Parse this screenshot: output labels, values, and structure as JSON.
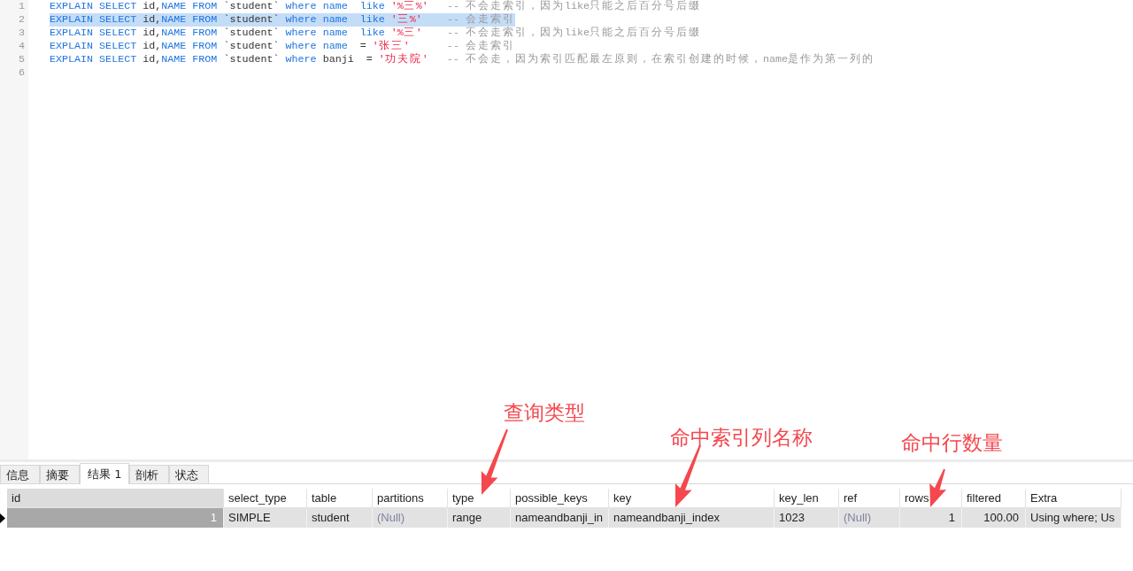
{
  "editor": {
    "lines": [
      {
        "number": "1",
        "selected": false,
        "tokens": [
          {
            "kind": "keyword",
            "text": "EXPLAIN SELECT"
          },
          {
            "kind": "plain",
            "text": " id,"
          },
          {
            "kind": "keyword",
            "text": "NAME FROM"
          },
          {
            "kind": "plain",
            "text": " `student` "
          },
          {
            "kind": "keyword",
            "text": "where name  like "
          },
          {
            "kind": "string",
            "text": "'%三%'"
          },
          {
            "kind": "comment",
            "text": "   -- 不会走索引，因为like只能之后百分号后缀"
          }
        ]
      },
      {
        "number": "2",
        "selected": true,
        "tokens": [
          {
            "kind": "keyword",
            "text": "EXPLAIN SELECT"
          },
          {
            "kind": "plain",
            "text": " id,"
          },
          {
            "kind": "keyword",
            "text": "NAME FROM"
          },
          {
            "kind": "plain",
            "text": " `student` "
          },
          {
            "kind": "keyword",
            "text": "where name  like "
          },
          {
            "kind": "string",
            "text": "'三%'"
          },
          {
            "kind": "comment",
            "text": "    -- 会走索引"
          }
        ]
      },
      {
        "number": "3",
        "selected": false,
        "tokens": [
          {
            "kind": "keyword",
            "text": "EXPLAIN SELECT"
          },
          {
            "kind": "plain",
            "text": " id,"
          },
          {
            "kind": "keyword",
            "text": "NAME FROM"
          },
          {
            "kind": "plain",
            "text": " `student` "
          },
          {
            "kind": "keyword",
            "text": "where name  like "
          },
          {
            "kind": "string",
            "text": "'%三'"
          },
          {
            "kind": "comment",
            "text": "    -- 不会走索引，因为like只能之后百分号后缀"
          }
        ]
      },
      {
        "number": "4",
        "selected": false,
        "tokens": [
          {
            "kind": "keyword",
            "text": "EXPLAIN SELECT"
          },
          {
            "kind": "plain",
            "text": " id,"
          },
          {
            "kind": "keyword",
            "text": "NAME FROM"
          },
          {
            "kind": "plain",
            "text": " `student` "
          },
          {
            "kind": "keyword",
            "text": "where name"
          },
          {
            "kind": "plain",
            "text": "  = "
          },
          {
            "kind": "string",
            "text": "'张三'"
          },
          {
            "kind": "comment",
            "text": "      -- 会走索引"
          }
        ]
      },
      {
        "number": "5",
        "selected": false,
        "tokens": [
          {
            "kind": "keyword",
            "text": "EXPLAIN SELECT"
          },
          {
            "kind": "plain",
            "text": " id,"
          },
          {
            "kind": "keyword",
            "text": "NAME FROM"
          },
          {
            "kind": "plain",
            "text": " `student` "
          },
          {
            "kind": "keyword",
            "text": "where"
          },
          {
            "kind": "plain",
            "text": " banji  = "
          },
          {
            "kind": "string",
            "text": "'功夫院'"
          },
          {
            "kind": "comment",
            "text": "   -- 不会走，因为索引匹配最左原则，在索引创建的时候，name是作为第一列的"
          }
        ]
      },
      {
        "number": "6",
        "selected": false
      }
    ]
  },
  "result_tabs": [
    {
      "label": "信息",
      "selected": false
    },
    {
      "label": "摘要",
      "selected": false
    },
    {
      "label": "结果 1",
      "selected": true
    },
    {
      "label": "剖析",
      "selected": false
    },
    {
      "label": "状态",
      "selected": false
    }
  ],
  "result_table": {
    "columns": [
      {
        "label": "id",
        "selected": true
      },
      {
        "label": "select_type",
        "selected": false
      },
      {
        "label": "table",
        "selected": false
      },
      {
        "label": "partitions",
        "selected": false
      },
      {
        "label": "type",
        "selected": false
      },
      {
        "label": "possible_keys",
        "selected": false
      },
      {
        "label": "key",
        "selected": false
      },
      {
        "label": "key_len",
        "selected": false
      },
      {
        "label": "ref",
        "selected": false
      },
      {
        "label": "rows",
        "selected": false
      },
      {
        "label": "filtered",
        "selected": false
      },
      {
        "label": "Extra",
        "selected": false
      }
    ],
    "rows": [
      {
        "selected": true,
        "cells": [
          {
            "text": "1",
            "kind": "number",
            "focused": true
          },
          {
            "text": "SIMPLE",
            "kind": "text",
            "focused": false
          },
          {
            "text": "student",
            "kind": "text",
            "focused": false
          },
          {
            "text": "(Null)",
            "kind": "null",
            "focused": false
          },
          {
            "text": "range",
            "kind": "text",
            "focused": false
          },
          {
            "text": "nameandbanji_in",
            "kind": "text",
            "focused": false
          },
          {
            "text": "nameandbanji_index",
            "kind": "text",
            "focused": false
          },
          {
            "text": "1023",
            "kind": "text",
            "focused": false
          },
          {
            "text": "(Null)",
            "kind": "null",
            "focused": false
          },
          {
            "text": "1",
            "kind": "number",
            "focused": false
          },
          {
            "text": "100.00",
            "kind": "number",
            "focused": false
          },
          {
            "text": "Using where; Us",
            "kind": "text",
            "focused": false
          }
        ]
      }
    ]
  },
  "annotations": [
    {
      "text": "查询类型"
    },
    {
      "text": "命中索引列名称"
    },
    {
      "text": "命中行数量"
    }
  ]
}
